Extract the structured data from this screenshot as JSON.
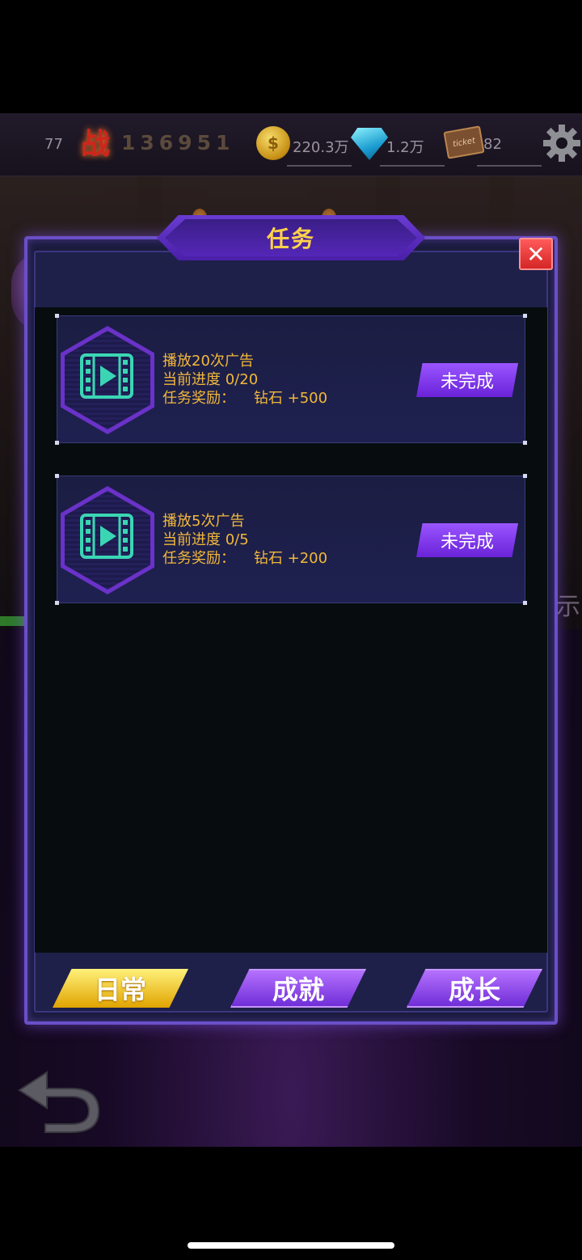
{
  "hud": {
    "level": "77",
    "power_icon_label": "战",
    "power_value": "136951",
    "coin_symbol": "$",
    "coin_value": "220.3万",
    "gem_value": "1.2万",
    "ticket_label": "ticket",
    "ticket_value": "82"
  },
  "background": {
    "side_text": "示"
  },
  "panel": {
    "title": "任务",
    "close_label": "✕",
    "tasks": [
      {
        "name": "播放20次广告",
        "progress": "当前进度 0/20",
        "reward": "任务奖励：    钻石 +500",
        "icon": "film-play-icon",
        "status": "未完成"
      },
      {
        "name": "播放5次广告",
        "progress": "当前进度 0/5",
        "reward": "任务奖励：    钻石 +200",
        "icon": "film-play-icon",
        "status": "未完成"
      }
    ],
    "tabs": [
      {
        "label": "日常",
        "active": true
      },
      {
        "label": "成就",
        "active": false
      },
      {
        "label": "成长",
        "active": false
      }
    ]
  },
  "colors": {
    "accent_purple": "#6a4fc8",
    "text_gold": "#f2b83a",
    "title_gold": "#ffd24a",
    "close_red": "#d52626"
  }
}
